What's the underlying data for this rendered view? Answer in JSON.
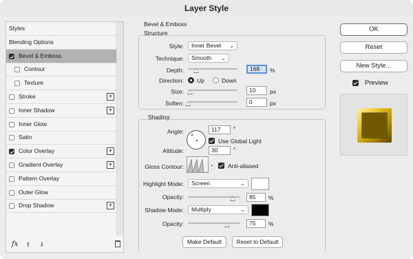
{
  "window": {
    "title": "Layer Style"
  },
  "styles_list": {
    "items": [
      {
        "label": "Styles",
        "checkbox": false,
        "checked": false,
        "plus": false,
        "selected": false,
        "indent": false
      },
      {
        "label": "Blending Options",
        "checkbox": false,
        "checked": false,
        "plus": false,
        "selected": false,
        "indent": false
      },
      {
        "label": "Bevel & Emboss",
        "checkbox": true,
        "checked": true,
        "plus": false,
        "selected": true,
        "indent": false
      },
      {
        "label": "Contour",
        "checkbox": true,
        "checked": false,
        "plus": false,
        "selected": false,
        "indent": true
      },
      {
        "label": "Texture",
        "checkbox": true,
        "checked": false,
        "plus": false,
        "selected": false,
        "indent": true
      },
      {
        "label": "Stroke",
        "checkbox": true,
        "checked": false,
        "plus": true,
        "selected": false,
        "indent": false
      },
      {
        "label": "Inner Shadow",
        "checkbox": true,
        "checked": false,
        "plus": true,
        "selected": false,
        "indent": false
      },
      {
        "label": "Inner Glow",
        "checkbox": true,
        "checked": false,
        "plus": false,
        "selected": false,
        "indent": false
      },
      {
        "label": "Satin",
        "checkbox": true,
        "checked": false,
        "plus": false,
        "selected": false,
        "indent": false
      },
      {
        "label": "Color Overlay",
        "checkbox": true,
        "checked": true,
        "plus": true,
        "selected": false,
        "indent": false
      },
      {
        "label": "Gradient Overlay",
        "checkbox": true,
        "checked": false,
        "plus": true,
        "selected": false,
        "indent": false
      },
      {
        "label": "Pattern Overlay",
        "checkbox": true,
        "checked": false,
        "plus": false,
        "selected": false,
        "indent": false
      },
      {
        "label": "Outer Glow",
        "checkbox": true,
        "checked": false,
        "plus": false,
        "selected": false,
        "indent": false
      },
      {
        "label": "Drop Shadow",
        "checkbox": true,
        "checked": false,
        "plus": true,
        "selected": false,
        "indent": false
      }
    ],
    "footer": {
      "fx_label": "fx",
      "up_glyph": "⬆",
      "down_glyph": "⬇"
    }
  },
  "bevel": {
    "title": "Bevel & Emboss",
    "structure": {
      "title": "Structure",
      "style_label": "Style:",
      "style_value": "Inner Bevel",
      "technique_label": "Technique:",
      "technique_value": "Smooth",
      "depth_label": "Depth:",
      "depth_value": "168",
      "depth_unit": "%",
      "depth_slider": 0.168,
      "direction_label": "Direction:",
      "direction_up": "Up",
      "direction_down": "Down",
      "direction_selected": "Up",
      "size_label": "Size:",
      "size_value": "10",
      "size_unit": "px",
      "size_slider": 0.04,
      "soften_label": "Soften:",
      "soften_value": "0",
      "soften_unit": "px",
      "soften_slider": 0.0
    },
    "shading": {
      "title": "Shading",
      "angle_label": "Angle:",
      "angle_value": "117",
      "angle_unit": "°",
      "global_light_label": "Use Global Light",
      "global_light_checked": true,
      "altitude_label": "Altitude:",
      "altitude_value": "30",
      "altitude_unit": "°",
      "gloss_label": "Gloss Contour:",
      "antialiased_label": "Anti-aliased",
      "antialiased_checked": true,
      "highlight_mode_label": "Highlight Mode:",
      "highlight_mode_value": "Screen",
      "highlight_color": "#ffffff",
      "highlight_opacity_label": "Opacity:",
      "highlight_opacity_value": "85",
      "highlight_opacity_unit": "%",
      "highlight_opacity_slider": 0.85,
      "shadow_mode_label": "Shadow Mode:",
      "shadow_mode_value": "Multiply",
      "shadow_color": "#000000",
      "shadow_opacity_label": "Opacity:",
      "shadow_opacity_value": "75",
      "shadow_opacity_unit": "%",
      "shadow_opacity_slider": 0.75
    },
    "make_default_label": "Make Default",
    "reset_default_label": "Reset to Default"
  },
  "actions": {
    "ok_label": "OK",
    "reset_label": "Reset",
    "new_style_label": "New Style...",
    "preview_label": "Preview",
    "preview_checked": true
  },
  "colors": {
    "selected_row": "#b2b2b2",
    "focus_border": "#5a8fd6",
    "preview_gold": "#8a7000"
  }
}
